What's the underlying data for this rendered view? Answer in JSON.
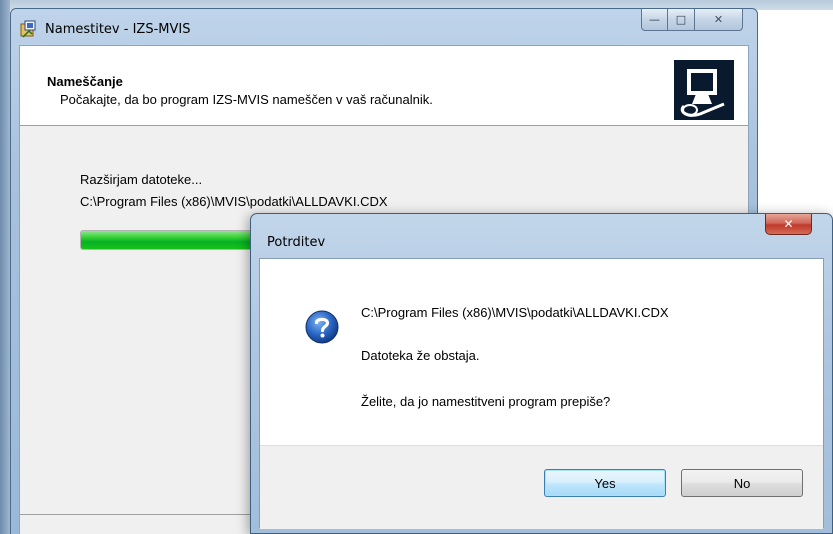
{
  "main_window": {
    "title": "Namestitev - IZS-MVIS",
    "caption_buttons": {
      "minimize": "—",
      "maximize": "□",
      "close": "✕"
    },
    "header": {
      "title": "Nameščanje",
      "subtitle": "Počakajte, da bo program IZS-MVIS nameščen v vaš računalnik."
    },
    "status_text": "Razširjam datoteke...",
    "current_file": "C:\\Program Files (x86)\\MVIS\\podatki\\ALLDAVKI.CDX",
    "progress_fraction": 0.72,
    "icons": {
      "app": "installer-icon",
      "logo": "computer-install-logo"
    }
  },
  "dialog": {
    "title": "Potrditev",
    "close_label": "✕",
    "icon": "question-icon",
    "file_path": "C:\\Program Files (x86)\\MVIS\\podatki\\ALLDAVKI.CDX",
    "message": "Datoteka že obstaja.",
    "question": "Želite, da jo namestitveni program prepiše?",
    "yes_label": "Yes",
    "no_label": "No"
  },
  "colors": {
    "progress_green": "#06b025",
    "dialog_close_red": "#c0392b",
    "default_button_blue": "#3c7fb1"
  }
}
